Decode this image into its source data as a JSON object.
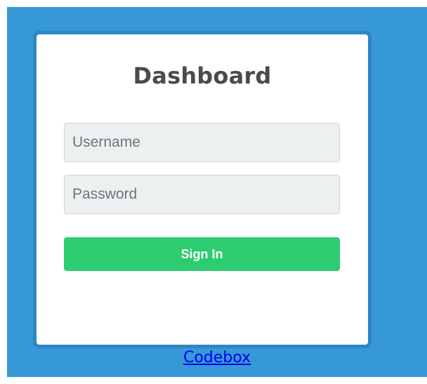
{
  "login": {
    "title": "Dashboard",
    "username_placeholder": "Username",
    "password_placeholder": "Password",
    "sign_in_label": "Sign In"
  },
  "footer": {
    "link_label": "Codebox"
  },
  "colors": {
    "background": "#3798d8",
    "card": "#ffffff",
    "input_bg": "#ecf0f1",
    "button": "#2ecc71",
    "link": "#0000ee"
  }
}
